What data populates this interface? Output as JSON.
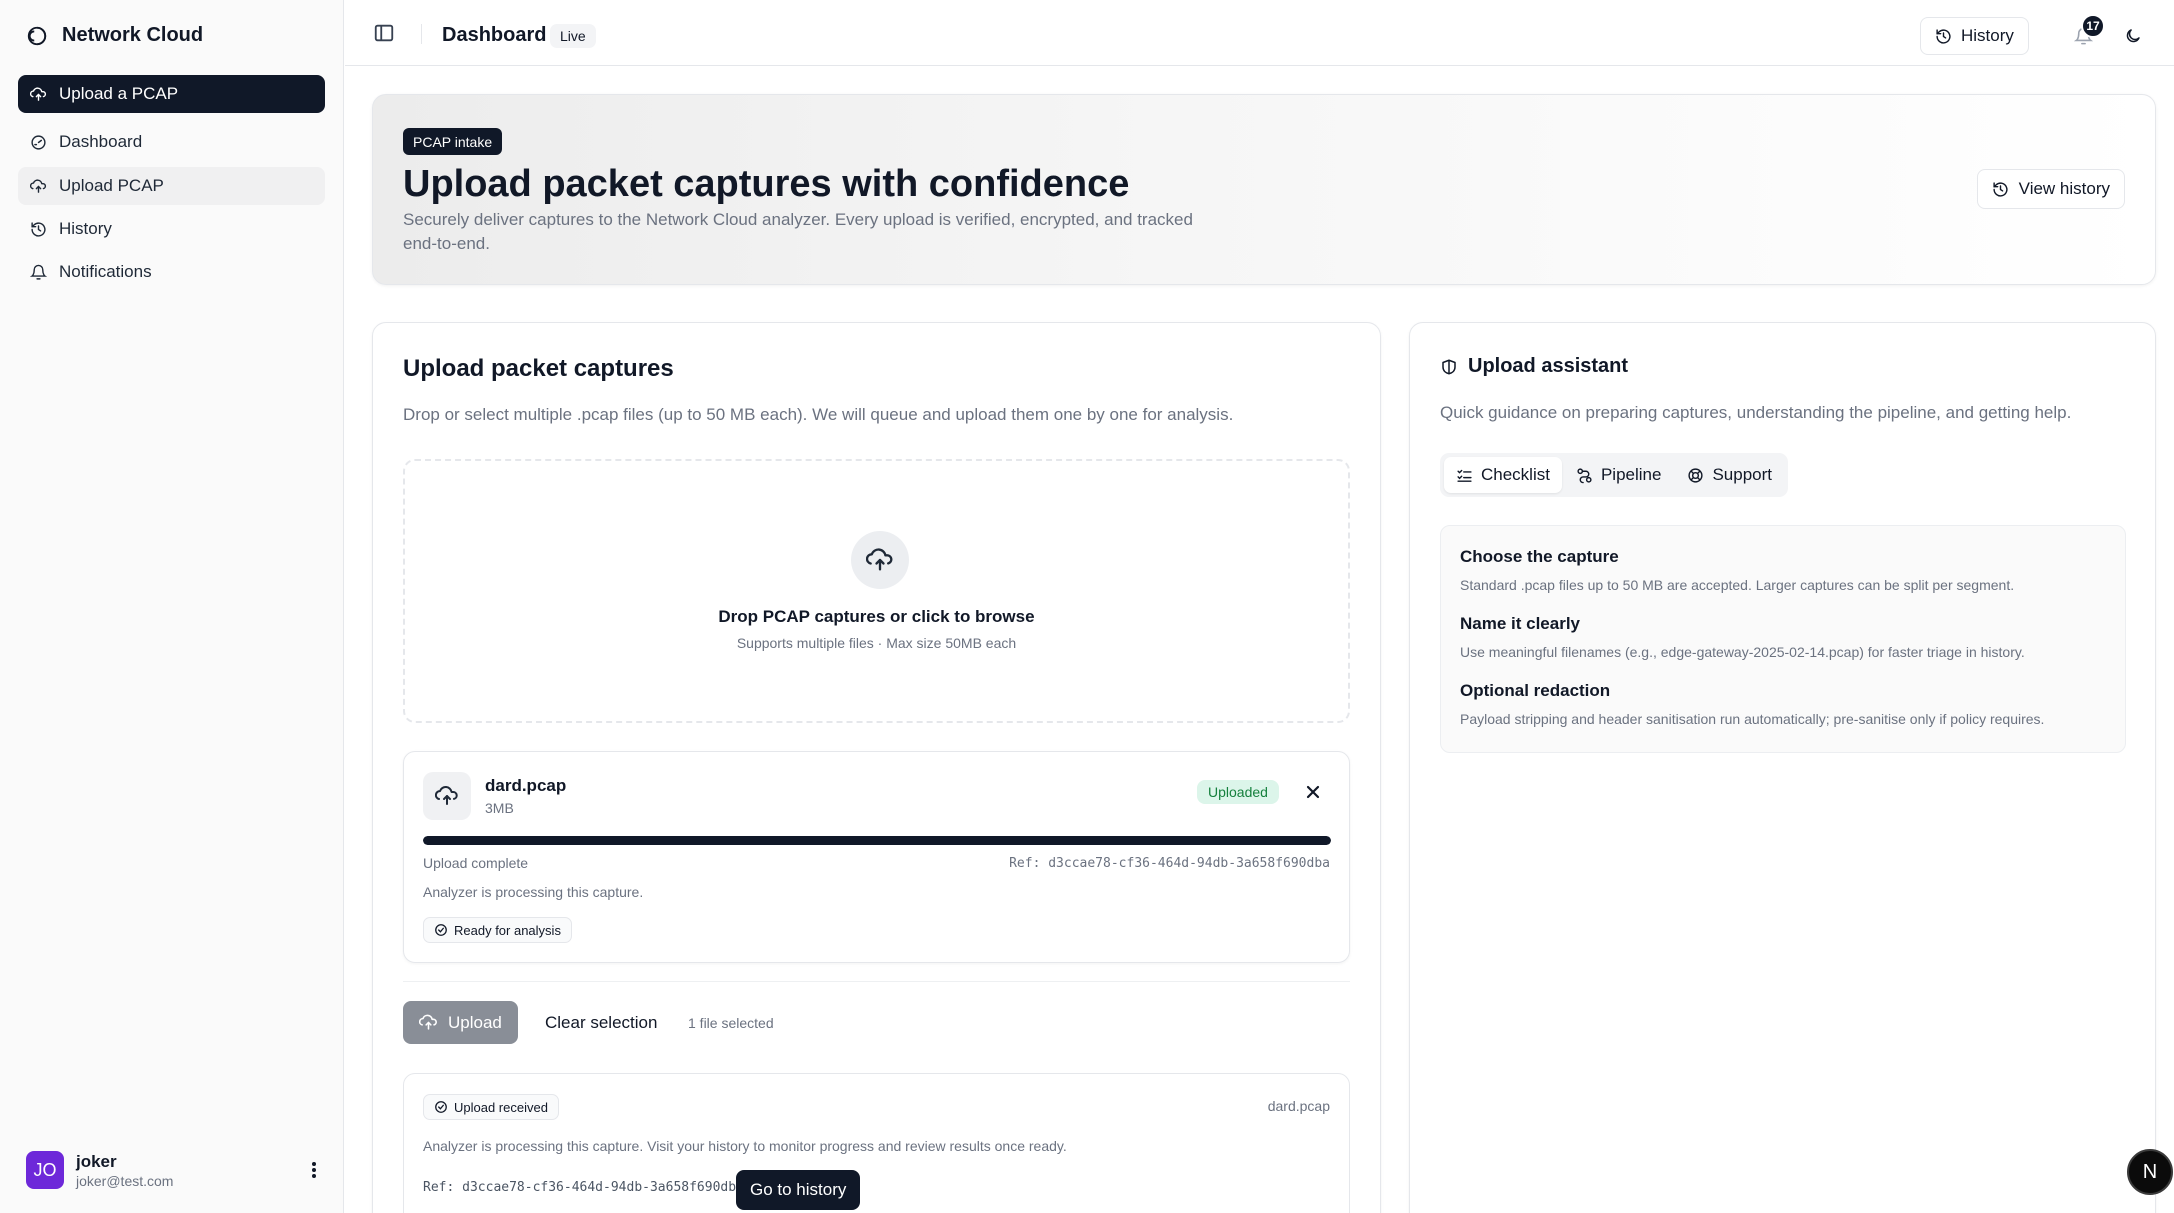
{
  "app": {
    "name": "Network Cloud"
  },
  "sidebar": {
    "items": [
      {
        "label": "Upload a PCAP",
        "icon": "cloud-upload-icon"
      },
      {
        "label": "Dashboard",
        "icon": "gauge-icon"
      },
      {
        "label": "Upload PCAP",
        "icon": "cloud-upload-icon"
      },
      {
        "label": "History",
        "icon": "history-icon"
      },
      {
        "label": "Notifications",
        "icon": "bell-icon"
      }
    ],
    "user": {
      "initials": "JO",
      "name": "joker",
      "email": "joker@test.com"
    }
  },
  "topbar": {
    "title": "Dashboard",
    "live_label": "Live",
    "history_label": "History",
    "notification_count": "17"
  },
  "hero": {
    "badge": "PCAP intake",
    "title": "Upload packet captures with confidence",
    "description": "Securely deliver captures to the Network Cloud analyzer. Every upload is verified, encrypted, and tracked end-to-end.",
    "view_history_label": "View history"
  },
  "upload": {
    "title": "Upload packet captures",
    "description": "Drop or select multiple .pcap files (up to 50 MB each). We will queue and upload them one by one for analysis.",
    "dropzone": {
      "title": "Drop PCAP captures or click to browse",
      "subtitle": "Supports multiple files · Max size 50MB each"
    },
    "file": {
      "name": "dard.pcap",
      "size": "3MB",
      "status": "Uploaded",
      "progress_percent": 100,
      "complete_label": "Upload complete",
      "ref": "Ref: d3ccae78-cf36-464d-94db-3a658f690dba",
      "processing": "Analyzer is processing this capture.",
      "ready_label": "Ready for analysis"
    },
    "actions": {
      "upload_label": "Upload",
      "clear_label": "Clear selection",
      "selected_count": "1 file selected"
    },
    "received": {
      "badge": "Upload received",
      "filename": "dard.pcap",
      "description": "Analyzer is processing this capture. Visit your history to monitor progress and review results once ready.",
      "ref": "Ref: d3ccae78-cf36-464d-94db-3a658f690dba",
      "goto_label": "Go to history"
    }
  },
  "assistant": {
    "title": "Upload assistant",
    "description": "Quick guidance on preparing captures, understanding the pipeline, and getting help.",
    "tabs": [
      {
        "label": "Checklist",
        "active": true
      },
      {
        "label": "Pipeline",
        "active": false
      },
      {
        "label": "Support",
        "active": false
      }
    ],
    "checklist": [
      {
        "title": "Choose the capture",
        "desc": "Standard .pcap files up to 50 MB are accepted. Larger captures can be split per segment."
      },
      {
        "title": "Name it clearly",
        "desc": "Use meaningful filenames (e.g., edge-gateway-2025-02-14.pcap) for faster triage in history."
      },
      {
        "title": "Optional redaction",
        "desc": "Payload stripping and header sanitisation run automatically; pre-sanitise only if policy requires."
      }
    ]
  },
  "fab": {
    "label": "N"
  }
}
